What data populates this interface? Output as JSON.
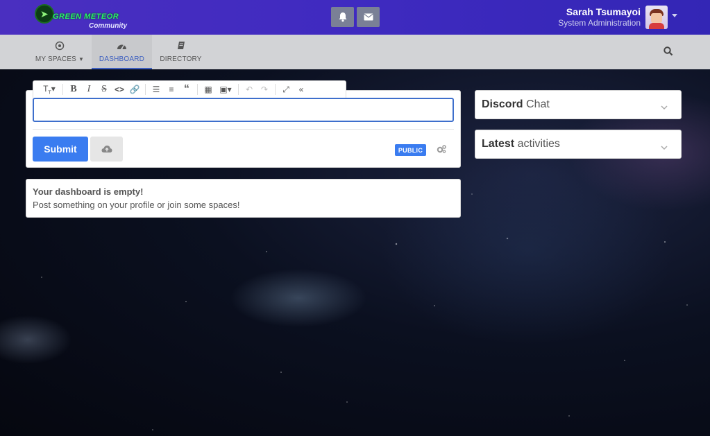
{
  "header": {
    "logo_text": "GREEN METEOR",
    "logo_sub": "Community",
    "user_name": "Sarah Tsumayoi",
    "user_role": "System Administration"
  },
  "nav": {
    "items": [
      {
        "label": "MY SPACES",
        "icon": "target-icon"
      },
      {
        "label": "DASHBOARD",
        "icon": "dashboard-icon"
      },
      {
        "label": "DIRECTORY",
        "icon": "book-icon"
      }
    ],
    "active": "DASHBOARD"
  },
  "composer": {
    "input_value": "",
    "submit_label": "Submit",
    "visibility_badge": "PUBLIC",
    "toolbar": [
      "heading",
      "bold",
      "italic",
      "strikethrough",
      "code",
      "link",
      "bullet-list",
      "ordered-list",
      "quote",
      "table",
      "image",
      "undo",
      "redo",
      "fullscreen",
      "collapse"
    ]
  },
  "empty_state": {
    "title": "Your dashboard is empty!",
    "text": "Post something on your profile or join some spaces!"
  },
  "sidebar": {
    "panels": [
      {
        "title_bold": "Discord",
        "title_rest": " Chat"
      },
      {
        "title_bold": "Latest",
        "title_rest": " activities"
      }
    ]
  },
  "colors": {
    "topbar": "#4a2fc0",
    "accent": "#3a7cf0",
    "nav_bg": "#d2d3d6"
  }
}
